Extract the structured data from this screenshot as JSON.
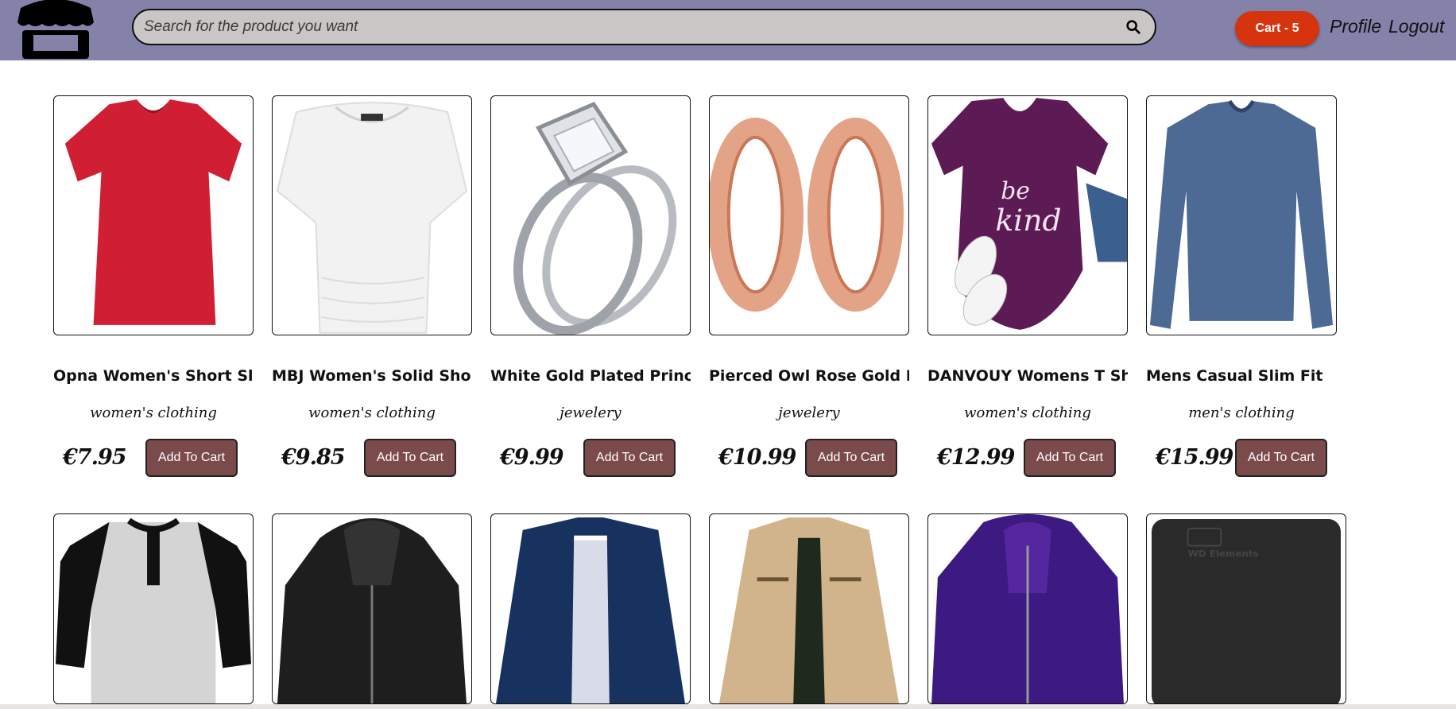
{
  "nav": {
    "search_placeholder": "Search for the product you want",
    "cart_label": "Cart - 5",
    "profile_label": "Profile",
    "logout_label": "Logout",
    "colors": {
      "bar": "#8582aa",
      "cart": "#d6330f",
      "button": "#7b4b4b"
    }
  },
  "products": [
    {
      "title": "Opna Women's Short Sleeve Moisture",
      "category": "women's clothing",
      "price": "€7.95",
      "button": "Add To Cart",
      "image": "red-vneck-tshirt"
    },
    {
      "title": "MBJ Women's Solid Short Sleeve",
      "category": "women's clothing",
      "price": "€9.85",
      "button": "Add To Cart",
      "image": "white-boatneck-top"
    },
    {
      "title": "White Gold Plated Princess",
      "category": "jewelery",
      "price": "€9.99",
      "button": "Add To Cart",
      "image": "diamond-ring"
    },
    {
      "title": "Pierced Owl Rose Gold Plated",
      "category": "jewelery",
      "price": "€10.99",
      "button": "Add To Cart",
      "image": "rose-gold-tunnels"
    },
    {
      "title": "DANVOUY Womens T Shirt",
      "category": "women's clothing",
      "price": "€12.99",
      "button": "Add To Cart",
      "image": "purple-be-kind-tshirt"
    },
    {
      "title": "Mens Casual Slim Fit",
      "category": "men's clothing",
      "price": "€15.99",
      "button": "Add To Cart",
      "image": "blue-longsleeve-shirt"
    }
  ],
  "products_row2": [
    {
      "image": "raglan-henley-shirt"
    },
    {
      "image": "black-leather-jacket"
    },
    {
      "image": "navy-rain-jacket"
    },
    {
      "image": "khaki-cotton-jacket"
    },
    {
      "image": "purple-snow-jacket"
    },
    {
      "image": "wd-external-drive",
      "logo_text": "WD Elements"
    }
  ]
}
